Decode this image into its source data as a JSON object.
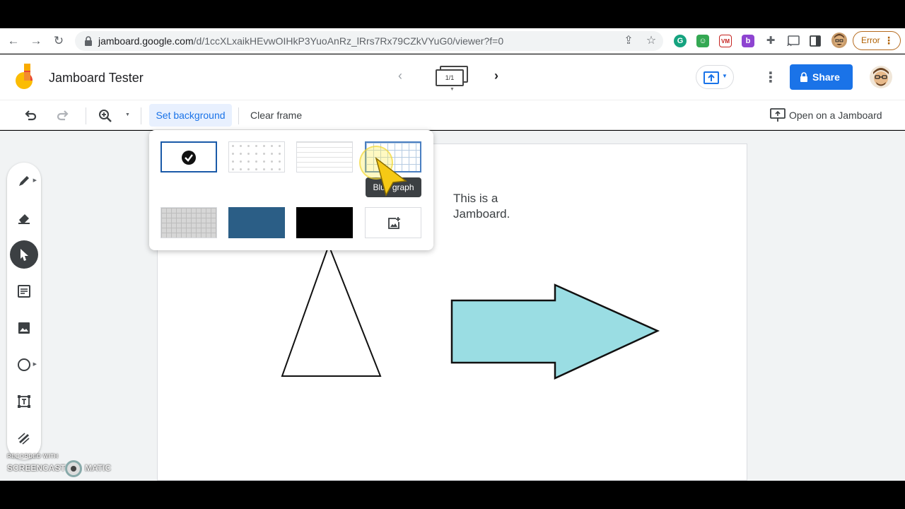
{
  "browser": {
    "url_host": "jamboard.google.com",
    "url_path": "/d/1ccXLxaikHEvwOIHkP3YuoAnRz_lRrs7Rx79CZkVYuG0/viewer?f=0",
    "error_label": "Error",
    "extensions": [
      "grammarly-icon",
      "green-ext-icon",
      "vm-ext-icon",
      "b-ext-icon",
      "puzzle-icon"
    ]
  },
  "app": {
    "title": "Jamboard Tester",
    "frame_indicator": "1/1",
    "share_label": "Share"
  },
  "toolbar": {
    "set_background_label": "Set background",
    "clear_frame_label": "Clear frame",
    "open_on_jamboard_label": "Open on a Jamboard"
  },
  "background_picker": {
    "options": [
      "plain",
      "dots",
      "lines",
      "blue-graph",
      "gray-graph",
      "blue",
      "black",
      "custom-image"
    ],
    "selected": "plain",
    "tooltip": "Blue graph"
  },
  "canvas": {
    "text_line_1": "This is a",
    "text_line_2": "Jamboard.",
    "arrow_fill": "#9adde3"
  },
  "tools": [
    "pen",
    "eraser",
    "select",
    "sticky-note",
    "image",
    "circle",
    "text-box",
    "laser"
  ],
  "watermark": {
    "small": "RECORDED WITH",
    "left": "SCREENCAST",
    "right": "MATIC"
  },
  "colors": {
    "accent": "#1a73e8",
    "selected_border": "#1a5aa8"
  }
}
